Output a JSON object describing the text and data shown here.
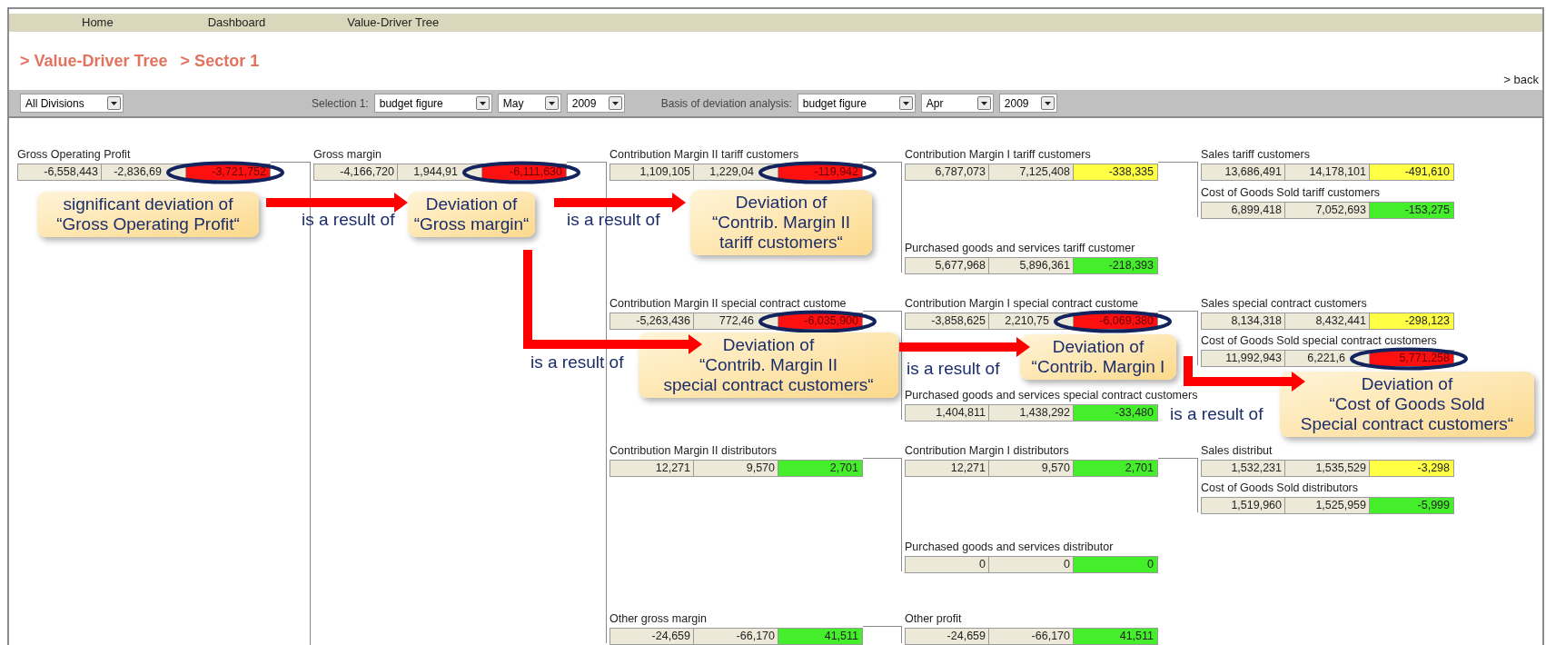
{
  "nav": {
    "items": [
      "Home",
      "Dashboard",
      "Value-Driver Tree"
    ]
  },
  "breadcrumb": [
    "> Value-Driver Tree",
    "> Sector 1"
  ],
  "back_link": "> back",
  "toolbar": {
    "division": "All Divisions",
    "selection_label": "Selection 1:",
    "selection": [
      "budget figure",
      "May",
      "2009"
    ],
    "basis_label": "Basis of deviation analysis:",
    "basis": [
      "budget figure",
      "Apr",
      "2009"
    ]
  },
  "tree": {
    "label": "Gross Operating Profit",
    "values": [
      "-6,558,443",
      "-2,836,69",
      "-3,721,752"
    ],
    "color": "#ff1010",
    "circled": true,
    "children": [
      {
        "label": "Gross margin",
        "values": [
          "-4,166,720",
          "1,944,91",
          "-6,111,630"
        ],
        "color": "#ff1010",
        "circled": true,
        "children": [
          {
            "label": "Contribution Margin II tariff customers",
            "values": [
              "1,109,105",
              "1,229,04",
              "-119,942"
            ],
            "color": "#ff1010",
            "circled": true,
            "children": [
              {
                "label": "Contribution Margin I tariff customers",
                "values": [
                  "6,787,073",
                  "7,125,408",
                  "-338,335"
                ],
                "color": "#ffff44",
                "circled": false,
                "children": [
                  {
                    "label": "Sales tariff customers",
                    "values": [
                      "13,686,491",
                      "14,178,101",
                      "-491,610"
                    ],
                    "color": "#ffff44",
                    "circled": false
                  },
                  {
                    "label": "Cost of Goods Sold tariff customers",
                    "values": [
                      "6,899,418",
                      "7,052,693",
                      "-153,275"
                    ],
                    "color": "#44ee2a",
                    "circled": false
                  }
                ]
              },
              {
                "label": "Purchased goods and services tariff customer",
                "values": [
                  "5,677,968",
                  "5,896,361",
                  "-218,393"
                ],
                "color": "#44ee2a",
                "circled": false
              }
            ]
          },
          {
            "label": "Contribution Margin II special contract custome",
            "values": [
              "-5,263,436",
              "772,46",
              "-6,035,900"
            ],
            "color": "#ff1010",
            "circled": true,
            "children": [
              {
                "label": "Contribution Margin I special contract custome",
                "values": [
                  "-3,858,625",
                  "2,210,75",
                  "-6,069,380"
                ],
                "color": "#ff1010",
                "circled": true,
                "children": [
                  {
                    "label": "Sales special contract customers",
                    "values": [
                      "8,134,318",
                      "8,432,441",
                      "-298,123"
                    ],
                    "color": "#ffff44",
                    "circled": false
                  },
                  {
                    "label": "Cost of Goods Sold special contract customers",
                    "values": [
                      "11,992,943",
                      "6,221,6",
                      "5,771,258"
                    ],
                    "color": "#ff1010",
                    "circled": true
                  }
                ]
              },
              {
                "label": "Purchased goods and services special contract customers",
                "values": [
                  "1,404,811",
                  "1,438,292",
                  "-33,480"
                ],
                "color": "#44ee2a",
                "circled": false
              }
            ]
          },
          {
            "label": "Contribution Margin II distributors",
            "values": [
              "12,271",
              "9,570",
              "2,701"
            ],
            "color": "#44ee2a",
            "circled": false,
            "children": [
              {
                "label": "Contribution Margin I distributors",
                "values": [
                  "12,271",
                  "9,570",
                  "2,701"
                ],
                "color": "#44ee2a",
                "circled": false,
                "children": [
                  {
                    "label": "Sales distribut",
                    "values": [
                      "1,532,231",
                      "1,535,529",
                      "-3,298"
                    ],
                    "color": "#ffff44",
                    "circled": false
                  },
                  {
                    "label": "Cost of Goods Sold distributors",
                    "values": [
                      "1,519,960",
                      "1,525,959",
                      "-5,999"
                    ],
                    "color": "#44ee2a",
                    "circled": false
                  }
                ]
              },
              {
                "label": "Purchased goods and services distributor",
                "values": [
                  "0",
                  "0",
                  "0"
                ],
                "color": "#44ee2a",
                "circled": false
              }
            ]
          },
          {
            "label": "Other gross margin",
            "values": [
              "-24,659",
              "-66,170",
              "41,511"
            ],
            "color": "#44ee2a",
            "circled": false,
            "children": [
              {
                "label": "Other profit",
                "values": [
                  "-24,659",
                  "-66,170",
                  "41,511"
                ],
                "color": "#44ee2a",
                "circled": false
              }
            ]
          }
        ]
      }
    ]
  },
  "annotations": {
    "callouts": [
      "significant deviation of\n“Gross Operating Profit“",
      "Deviation of\n“Gross margin“",
      "Deviation of\n“Contrib. Margin II\ntariff customers“",
      "Deviation of\n“Contrib. Margin II\nspecial contract customers“",
      "Deviation of\n“Contrib. Margin I",
      "Deviation of\n“Cost of Goods Sold\nSpecial contract customers“"
    ],
    "connector_labels": [
      "is a result of",
      "is a result of",
      "is a result of",
      "is a result of",
      "is a result of"
    ]
  }
}
